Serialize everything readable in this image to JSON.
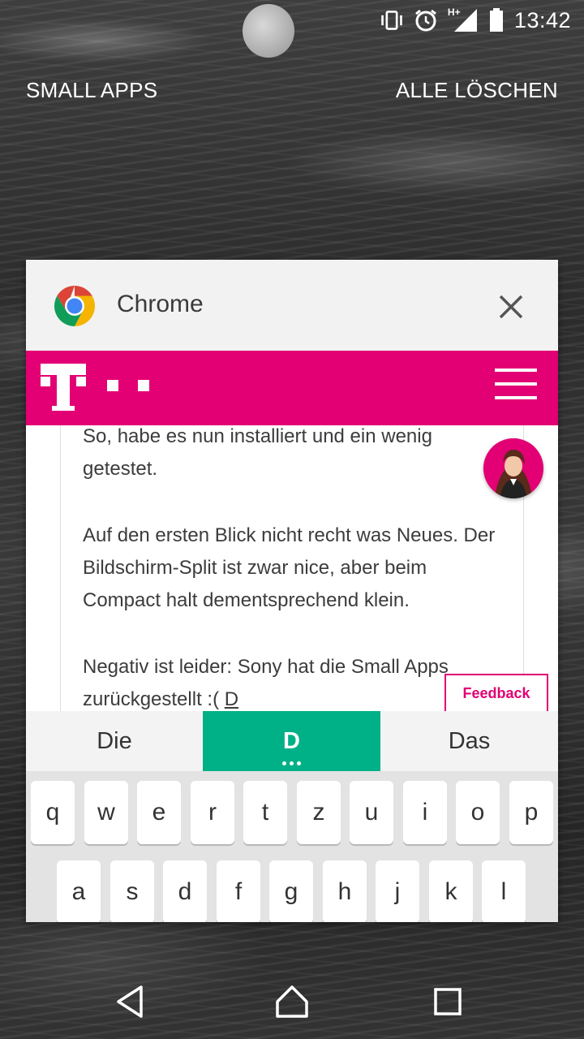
{
  "status_bar": {
    "time": "13:42",
    "icons": [
      "vibrate-icon",
      "alarm-icon",
      "signal-hplus-icon",
      "battery-icon"
    ],
    "network_label": "H+"
  },
  "top_actions": {
    "small_apps": "SMALL APPS",
    "clear_all": "ALLE LÖSCHEN"
  },
  "card": {
    "app_name": "Chrome",
    "app_icon": "chrome-icon",
    "close_icon": "close-icon"
  },
  "website": {
    "brand_color": "#e20074",
    "logo": "telekom-t-logo",
    "menu_icon": "hamburger-menu-icon",
    "post_paragraphs": [
      "So, habe es nun installiert und ein wenig getestet.",
      "Auf den ersten Blick nicht recht was Neues. Der Bildschirm-Split ist zwar nice, aber beim Compact halt dementsprechend klein.",
      "Negativ ist leider: Sony hat die Small Apps zurückgestellt :("
    ],
    "typing_word": "D",
    "feedback_label": "Feedback"
  },
  "keyboard": {
    "suggestions": [
      "Die",
      "D",
      "Das"
    ],
    "accent_color": "#00b087",
    "row1": [
      "q",
      "w",
      "e",
      "r",
      "t",
      "z",
      "u",
      "i",
      "o",
      "p"
    ],
    "row2": [
      "a",
      "s",
      "d",
      "f",
      "g",
      "h",
      "j",
      "k",
      "l"
    ]
  },
  "navigation": {
    "back": "back-icon",
    "home": "home-icon",
    "recents": "recents-icon"
  }
}
